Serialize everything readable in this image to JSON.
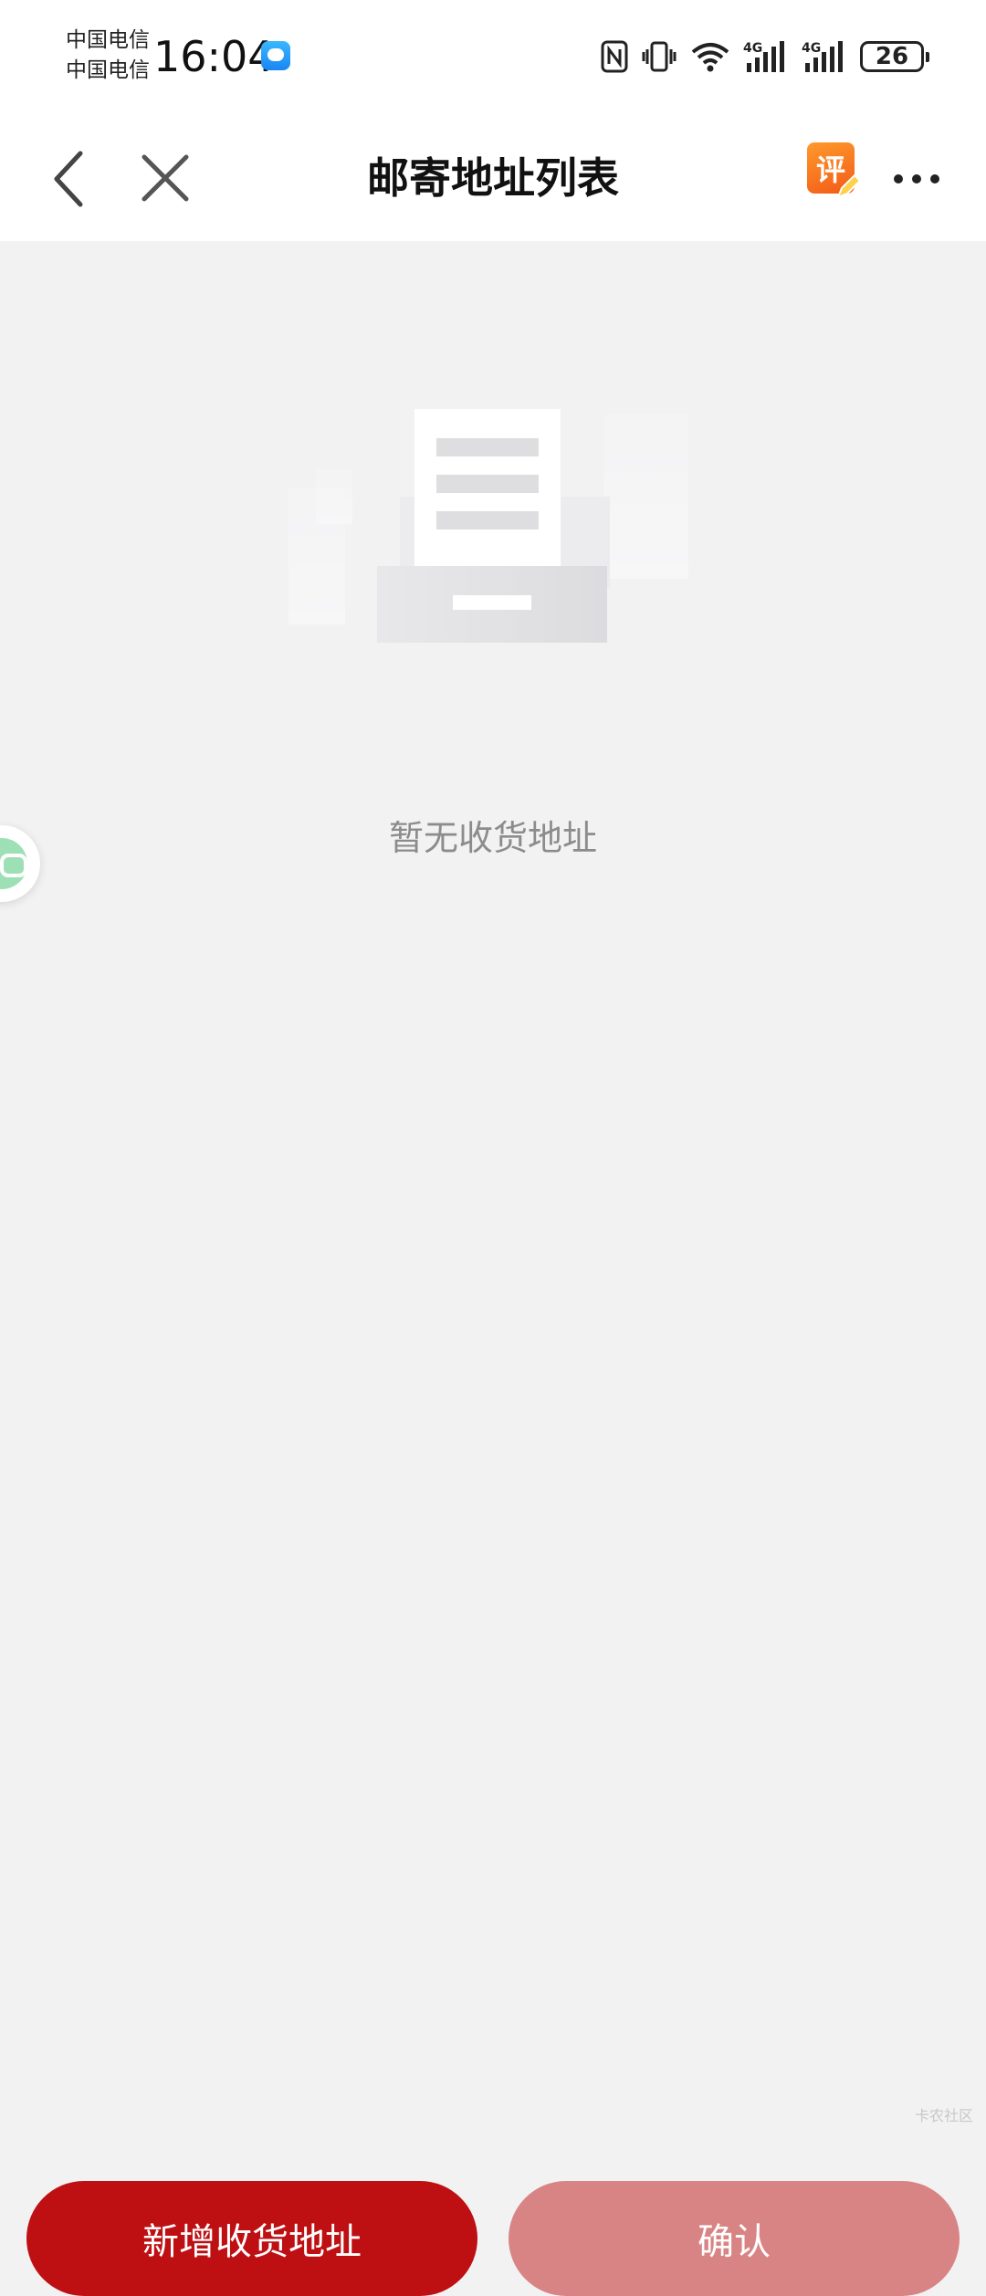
{
  "status_bar": {
    "carrier_1": "中国电信",
    "carrier_2": "中国电信",
    "time": "16:04",
    "signal_1_label": "4G",
    "signal_2_label": "4G",
    "battery_level": "26",
    "icons": [
      "message-app-icon",
      "nfc-icon",
      "vibrate-icon",
      "wifi-icon",
      "signal-4g-icon",
      "signal-4g-icon",
      "battery-icon"
    ]
  },
  "header": {
    "title": "邮寄地址列表",
    "review_badge": "评",
    "icons": [
      "back-arrow-icon",
      "close-icon",
      "review-icon",
      "more-icon"
    ]
  },
  "empty_state": {
    "message": "暂无收货地址",
    "icon": "empty-document-tray-illustration"
  },
  "floating": {
    "icon": "customer-service-chat-icon"
  },
  "actions": {
    "add_label": "新增收货地址",
    "confirm_label": "确认"
  },
  "watermark": "卡农社区",
  "colors": {
    "primary_red": "#be0f13",
    "confirm_disabled": "#d98484",
    "background": "#f2f2f3",
    "empty_text": "#8c8c8c"
  }
}
